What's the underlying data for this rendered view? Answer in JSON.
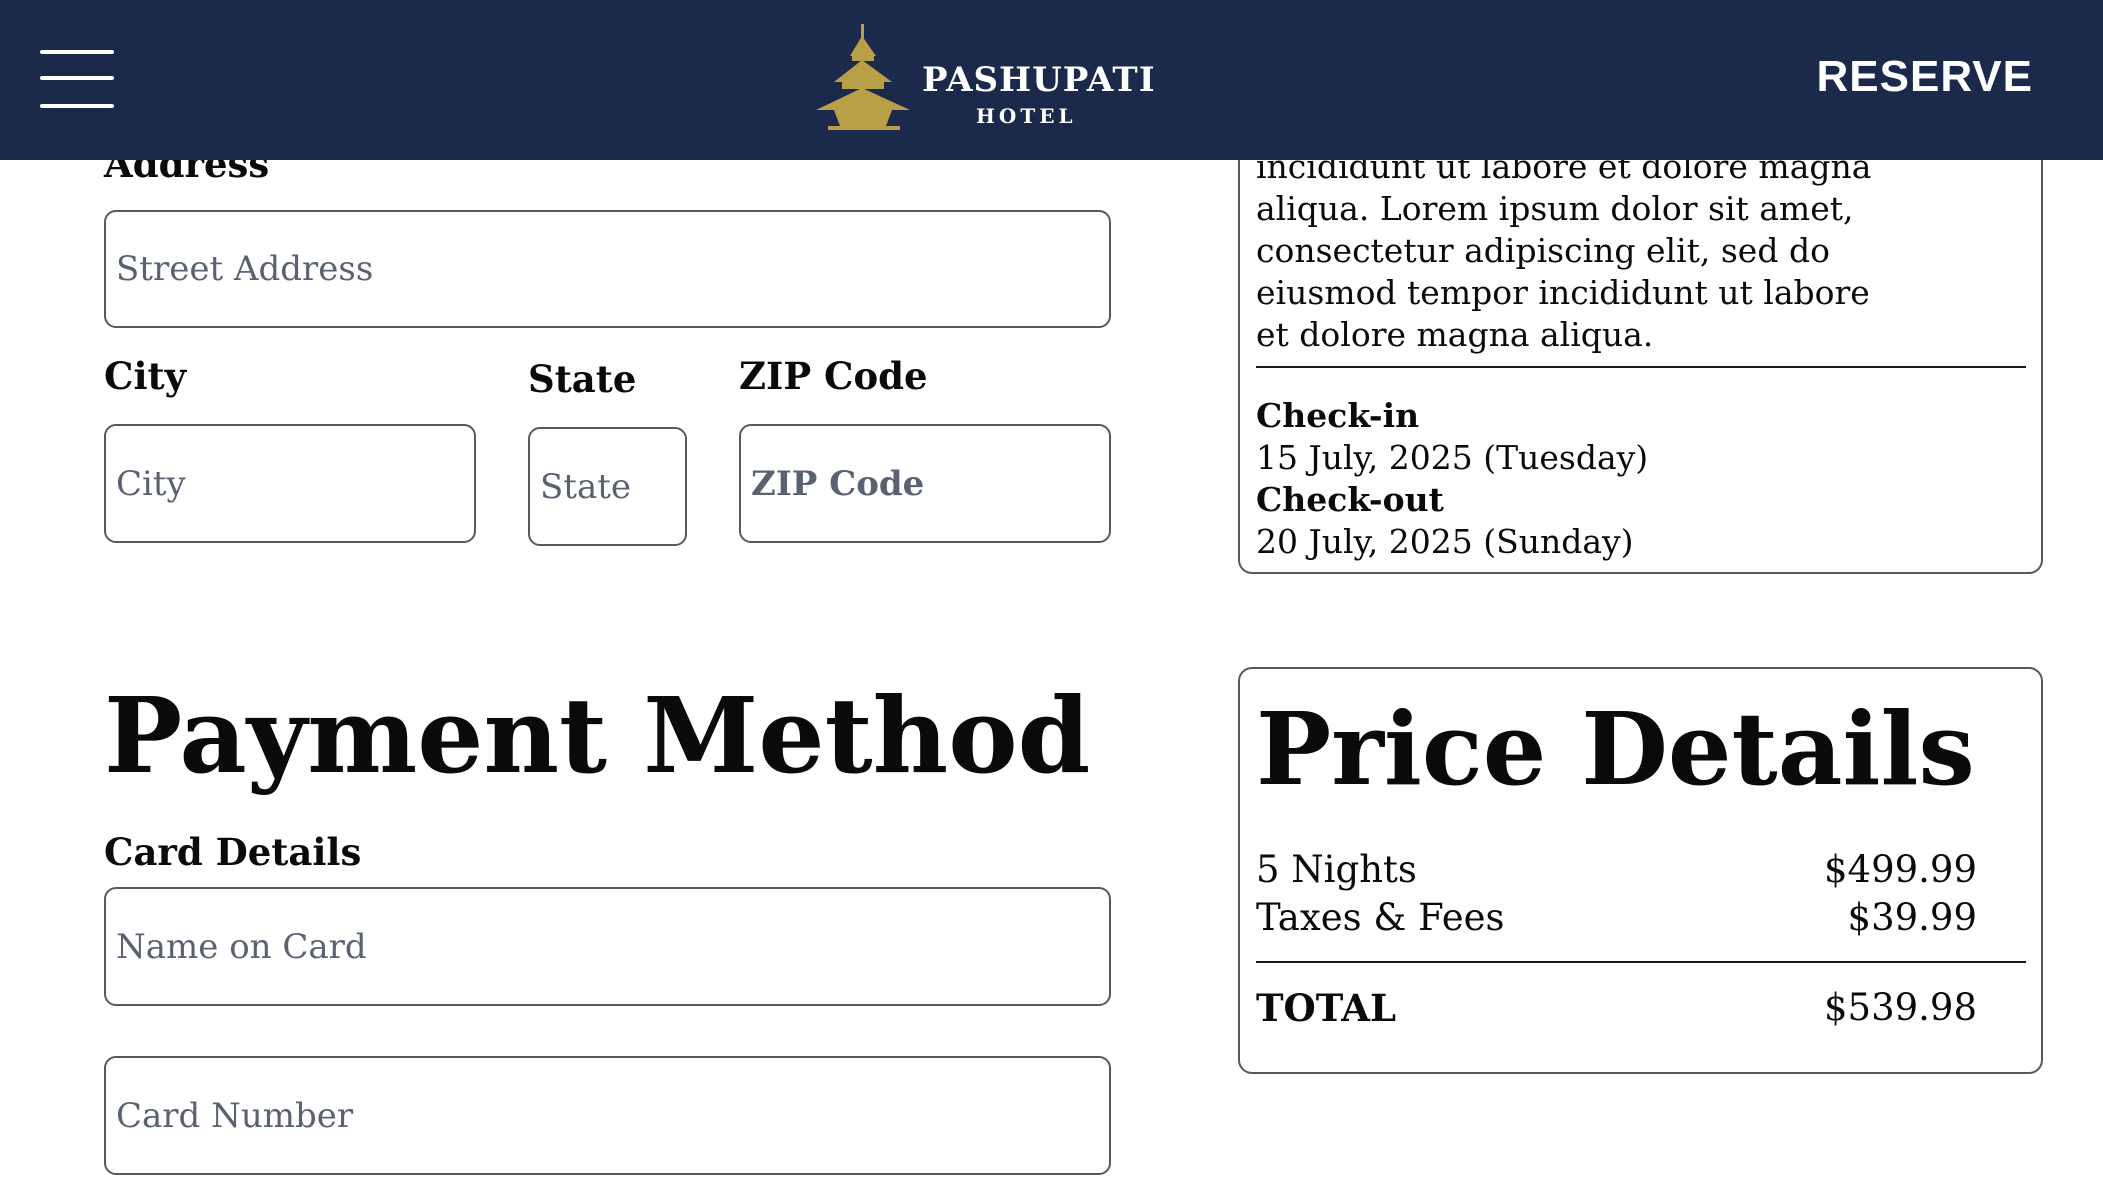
{
  "header": {
    "menu_icon": "hamburger-menu-icon",
    "logo_name": "PASHUPATI",
    "logo_sub": "HOTEL",
    "logo_icon": "pagoda-icon",
    "reserve_label": "RESERVE",
    "colors": {
      "background": "#1b2a4a",
      "logo_gold": "#b9a047",
      "text": "#ffffff"
    }
  },
  "address_section": {
    "address_label": "Address",
    "street_placeholder": "Street Address",
    "city_label": "City",
    "city_placeholder": "City",
    "state_label": "State",
    "state_placeholder": "State",
    "zip_label": "ZIP Code",
    "zip_placeholder": "ZIP Code"
  },
  "payment": {
    "title": "Payment Method",
    "card_details_label": "Card Details",
    "name_placeholder": "Name on Card",
    "number_placeholder": "Card Number"
  },
  "booking_summary": {
    "description": "incididunt ut labore et dolore magna aliqua. Lorem ipsum dolor sit amet, consectetur adipiscing elit, sed do eiusmod tempor incididunt ut labore et dolore magna aliqua.",
    "checkin_label": "Check-in",
    "checkin_value": "15 July, 2025 (Tuesday)",
    "checkout_label": "Check-out",
    "checkout_value": "20 July, 2025 (Sunday)"
  },
  "price_details": {
    "title": "Price Details",
    "rows": [
      {
        "label": "5 Nights",
        "amount": "$499.99"
      },
      {
        "label": "Taxes & Fees",
        "amount": "$39.99"
      }
    ],
    "total_label": "TOTAL",
    "total_amount": "$539.98"
  }
}
